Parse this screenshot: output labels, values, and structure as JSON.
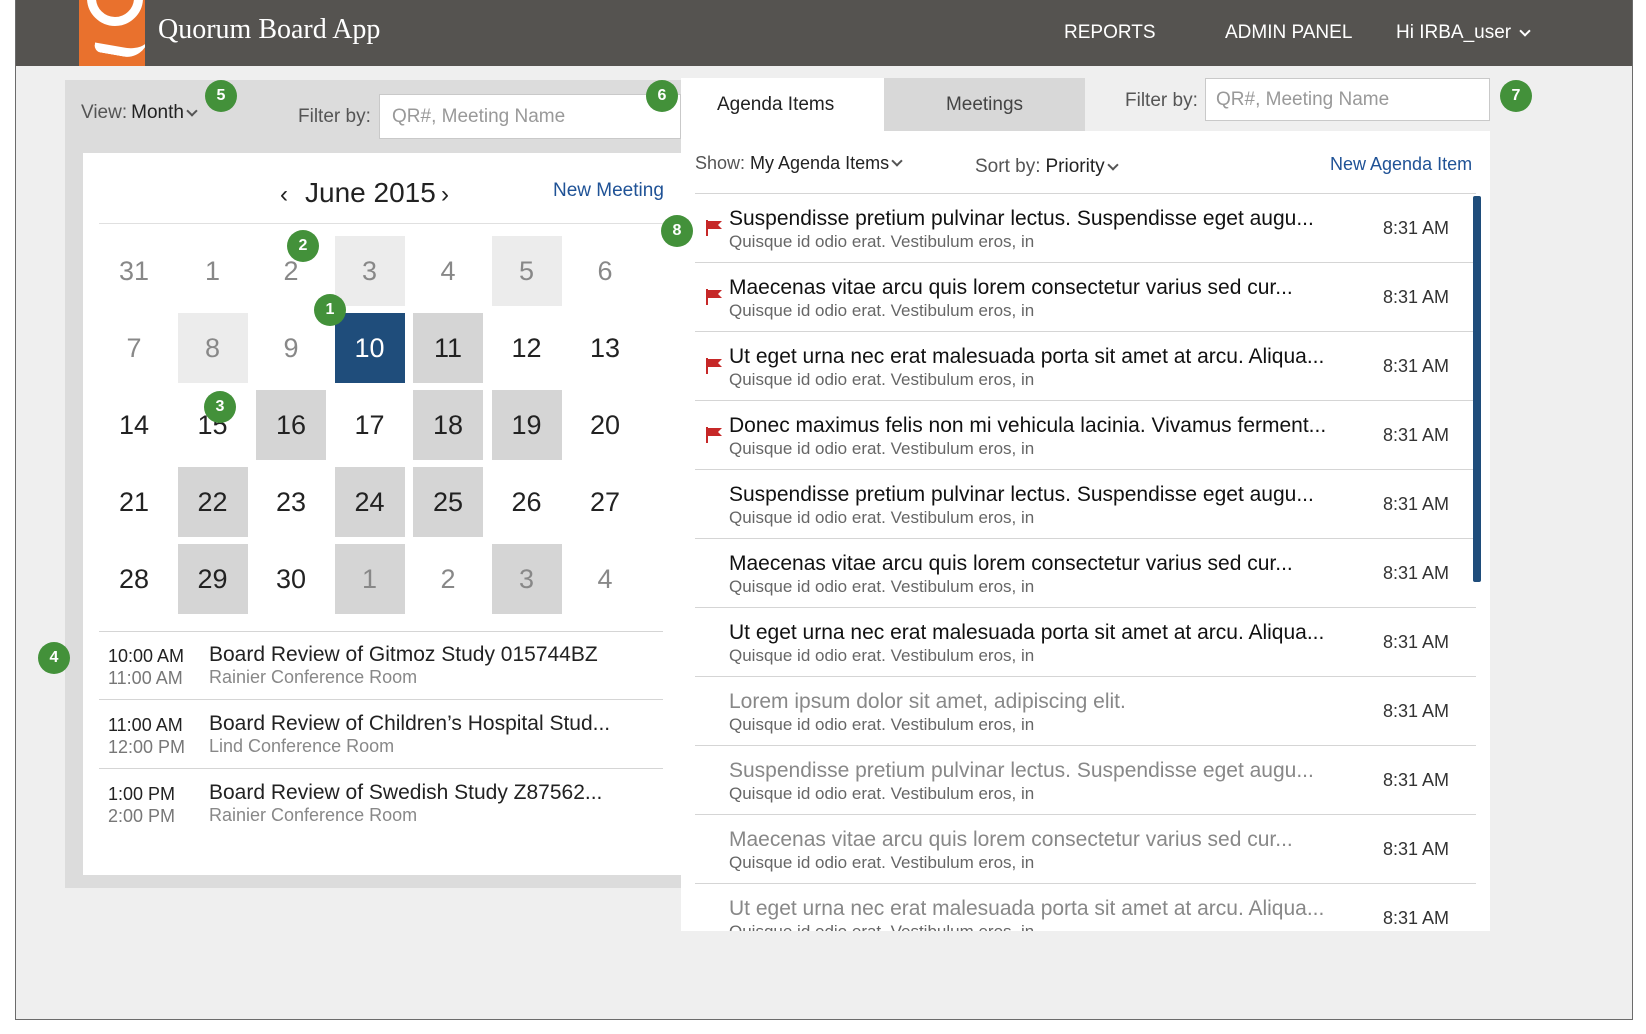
{
  "app": {
    "title": "Quorum Board App"
  },
  "nav": {
    "reports": "REPORTS",
    "admin": "ADMIN PANEL",
    "user": "Hi IRBA_user"
  },
  "left": {
    "view_label": "View:",
    "view_value": "Month",
    "filter_label": "Filter by:",
    "filter_placeholder": "QR#, Meeting Name",
    "month": "June 2015",
    "new_meeting": "New Meeting",
    "days": [
      {
        "n": "31",
        "style": "muted"
      },
      {
        "n": "1",
        "style": "muted"
      },
      {
        "n": "2",
        "style": "muted"
      },
      {
        "n": "3",
        "style": "muted light"
      },
      {
        "n": "4",
        "style": "muted"
      },
      {
        "n": "5",
        "style": "muted light"
      },
      {
        "n": "6",
        "style": "muted"
      },
      {
        "n": "7",
        "style": "muted"
      },
      {
        "n": "8",
        "style": "muted light"
      },
      {
        "n": "9",
        "style": "muted"
      },
      {
        "n": "10",
        "style": "sel"
      },
      {
        "n": "11",
        "style": "dark"
      },
      {
        "n": "12",
        "style": ""
      },
      {
        "n": "13",
        "style": ""
      },
      {
        "n": "14",
        "style": ""
      },
      {
        "n": "15",
        "style": ""
      },
      {
        "n": "16",
        "style": "dark"
      },
      {
        "n": "17",
        "style": ""
      },
      {
        "n": "18",
        "style": "dark"
      },
      {
        "n": "19",
        "style": "dark"
      },
      {
        "n": "20",
        "style": ""
      },
      {
        "n": "21",
        "style": ""
      },
      {
        "n": "22",
        "style": "dark"
      },
      {
        "n": "23",
        "style": ""
      },
      {
        "n": "24",
        "style": "dark"
      },
      {
        "n": "25",
        "style": "dark"
      },
      {
        "n": "26",
        "style": ""
      },
      {
        "n": "27",
        "style": ""
      },
      {
        "n": "28",
        "style": ""
      },
      {
        "n": "29",
        "style": "dark"
      },
      {
        "n": "30",
        "style": ""
      },
      {
        "n": "1",
        "style": "muted dark"
      },
      {
        "n": "2",
        "style": "muted"
      },
      {
        "n": "3",
        "style": "muted dark"
      },
      {
        "n": "4",
        "style": "muted"
      }
    ],
    "meetings": [
      {
        "start": "10:00 AM",
        "end": "11:00 AM",
        "title": "Board Review of Gitmoz Study 015744BZ",
        "room": "Rainier Conference Room"
      },
      {
        "start": "11:00 AM",
        "end": "12:00 PM",
        "title": "Board Review of Children’s Hospital Stud...",
        "room": "Lind Conference Room"
      },
      {
        "start": "1:00 PM",
        "end": "2:00 PM",
        "title": "Board Review of Swedish Study Z87562...",
        "room": "Rainier Conference Room"
      }
    ]
  },
  "right": {
    "tabs": {
      "agenda": "Agenda Items",
      "meetings": "Meetings"
    },
    "filter_label": "Filter by:",
    "filter_placeholder": "QR#, Meeting Name",
    "show_label": "Show:",
    "show_value": "My Agenda Items",
    "sort_label": "Sort by:",
    "sort_value": "Priority",
    "new_agenda": "New Agenda Item",
    "items": [
      {
        "title": "Suspendisse pretium pulvinar lectus. Suspendisse eget augu...",
        "sub": "Quisque id odio erat. Vestibulum eros, in",
        "time": "8:31 AM",
        "flag": true,
        "grey": false
      },
      {
        "title": "Maecenas vitae arcu quis lorem consectetur varius sed cur...",
        "sub": "Quisque id odio erat. Vestibulum eros, in",
        "time": "8:31 AM",
        "flag": true,
        "grey": false
      },
      {
        "title": "Ut eget urna nec erat malesuada porta sit amet at arcu. Aliqua...",
        "sub": "Quisque id odio erat. Vestibulum eros, in",
        "time": "8:31 AM",
        "flag": true,
        "grey": false
      },
      {
        "title": "Donec maximus felis non mi vehicula lacinia. Vivamus ferment...",
        "sub": "Quisque id odio erat. Vestibulum eros, in",
        "time": "8:31 AM",
        "flag": true,
        "grey": false
      },
      {
        "title": "Suspendisse pretium pulvinar lectus. Suspendisse eget augu...",
        "sub": "Quisque id odio erat. Vestibulum eros, in",
        "time": "8:31 AM",
        "flag": false,
        "grey": false
      },
      {
        "title": "Maecenas vitae arcu quis lorem consectetur varius sed cur...",
        "sub": "Quisque id odio erat. Vestibulum eros, in",
        "time": "8:31 AM",
        "flag": false,
        "grey": false
      },
      {
        "title": "Ut eget urna nec erat malesuada porta sit amet at arcu. Aliqua...",
        "sub": "Quisque id odio erat. Vestibulum eros, in",
        "time": "8:31 AM",
        "flag": false,
        "grey": false
      },
      {
        "title": "Lorem ipsum dolor sit amet, adipiscing elit.",
        "sub": "Quisque id odio erat. Vestibulum eros, in",
        "time": "8:31 AM",
        "flag": false,
        "grey": true
      },
      {
        "title": "Suspendisse pretium pulvinar lectus. Suspendisse eget augu...",
        "sub": "Quisque id odio erat. Vestibulum eros, in",
        "time": "8:31 AM",
        "flag": false,
        "grey": true
      },
      {
        "title": "Maecenas vitae arcu quis lorem consectetur varius sed cur...",
        "sub": "Quisque id odio erat. Vestibulum eros, in",
        "time": "8:31 AM",
        "flag": false,
        "grey": true
      },
      {
        "title": "Ut eget urna nec erat malesuada porta sit amet at arcu. Aliqua...",
        "sub": "Quisque id odio erat. Vestibulum eros, in",
        "time": "8:31 AM",
        "flag": false,
        "grey": true
      }
    ]
  },
  "callouts": [
    "1",
    "2",
    "3",
    "4",
    "5",
    "6",
    "7",
    "8"
  ],
  "colors": {
    "header": "#555350",
    "brand": "#e9712d",
    "selected": "#1f4d7b",
    "link": "#1f5296",
    "callout": "#43913a",
    "flag": "#c62828"
  }
}
